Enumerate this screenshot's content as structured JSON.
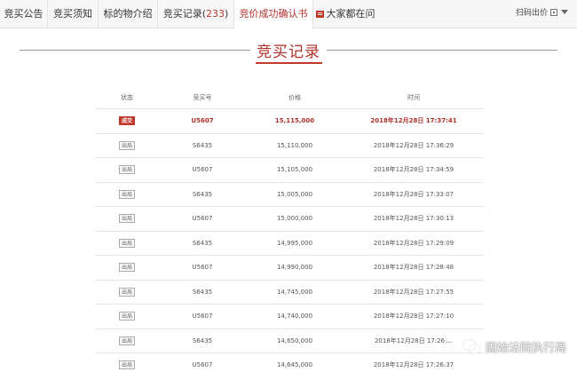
{
  "tabs": [
    {
      "label": "竞买公告"
    },
    {
      "label": "竞买须知"
    },
    {
      "label": "标的物介绍"
    },
    {
      "label": "竞买记录",
      "count": "233"
    },
    {
      "label": "竞价成功确认书"
    },
    {
      "label": "大家都在问"
    }
  ],
  "scan": {
    "label": "扫码出价"
  },
  "section_title": "竞买记录",
  "table": {
    "headers": [
      "状态",
      "竞买号",
      "价格",
      "时间"
    ],
    "rows": [
      {
        "status": "成交",
        "bidder": "U5607",
        "price": "15,115,000",
        "time": "2018年12月28日 17:37:41"
      },
      {
        "status": "出局",
        "bidder": "S6435",
        "price": "15,110,000",
        "time": "2018年12月28日 17:36:29"
      },
      {
        "status": "出局",
        "bidder": "U5607",
        "price": "15,105,000",
        "time": "2018年12月28日 17:34:59"
      },
      {
        "status": "出局",
        "bidder": "S6435",
        "price": "15,005,000",
        "time": "2018年12月28日 17:33:07"
      },
      {
        "status": "出局",
        "bidder": "U5607",
        "price": "15,000,000",
        "time": "2018年12月28日 17:30:13"
      },
      {
        "status": "出局",
        "bidder": "S6435",
        "price": "14,995,000",
        "time": "2018年12月28日 17:29:09"
      },
      {
        "status": "出局",
        "bidder": "U5607",
        "price": "14,990,000",
        "time": "2018年12月28日 17:28:48"
      },
      {
        "status": "出局",
        "bidder": "S6435",
        "price": "14,745,000",
        "time": "2018年12月28日 17:27:55"
      },
      {
        "status": "出局",
        "bidder": "U5607",
        "price": "14,740,000",
        "time": "2018年12月28日 17:27:10"
      },
      {
        "status": "出局",
        "bidder": "S6435",
        "price": "14,650,000",
        "time": "2018年12月28日 17:26:..."
      },
      {
        "status": "出局",
        "bidder": "U5607",
        "price": "14,645,000",
        "time": "2018年12月28日 17:26:37"
      }
    ]
  },
  "watermark": "固始法院执行局",
  "colors": {
    "accent": "#c0392b",
    "win_badge": "#c0392b"
  }
}
